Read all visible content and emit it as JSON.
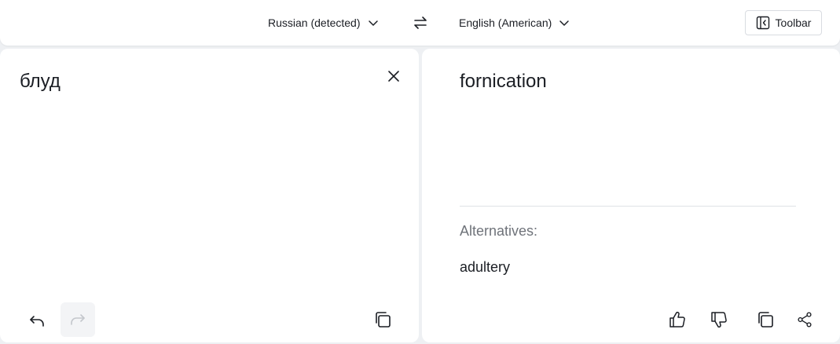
{
  "header": {
    "source_language": "Russian (detected)",
    "target_language": "English (American)",
    "toolbar_label": "Toolbar"
  },
  "source": {
    "text": "блуд"
  },
  "target": {
    "text": "fornication",
    "alternatives_label": "Alternatives:",
    "alternatives": [
      "adultery"
    ]
  },
  "icons": {
    "source_dropdown": "chevron-down-icon",
    "target_dropdown": "chevron-down-icon",
    "swap": "swap-arrows-icon",
    "toolbar": "sidebar-panel-icon",
    "clear": "close-icon",
    "undo": "undo-icon",
    "redo": "redo-icon",
    "copy": "copy-icon",
    "like": "thumbs-up-icon",
    "dislike": "thumbs-down-icon",
    "share": "share-icon"
  },
  "colors": {
    "background": "#eef0f3",
    "panel": "#ffffff",
    "text": "#1b1e24",
    "muted": "#6f737a",
    "disabled": "#c4c7cc"
  }
}
